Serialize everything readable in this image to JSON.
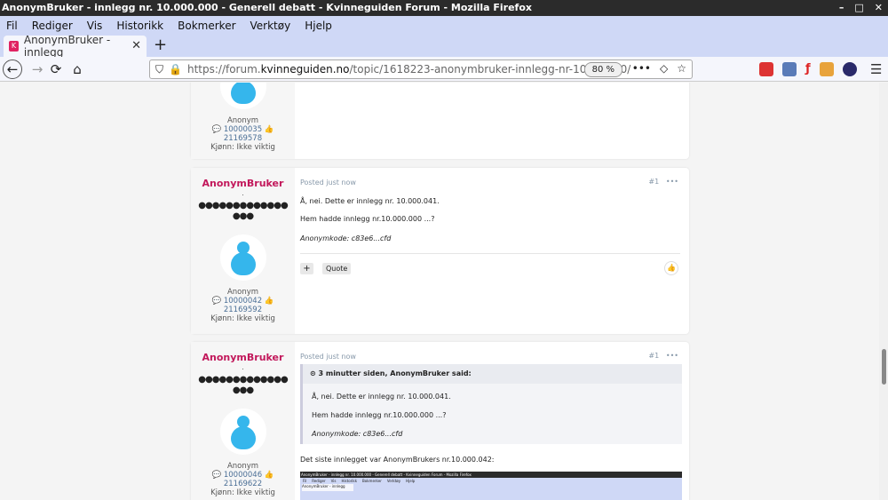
{
  "window": {
    "title": "AnonymBruker - innlegg nr. 10.000.000 - Generell debatt - Kvinneguiden Forum - Mozilla Firefox",
    "controls": [
      "–",
      "□",
      "✕"
    ]
  },
  "menu": [
    "Fil",
    "Rediger",
    "Vis",
    "Historikk",
    "Bokmerker",
    "Verktøy",
    "Hjelp"
  ],
  "tab": {
    "label": "AnonymBruker - innlegg",
    "close": "✕",
    "new": "+"
  },
  "nav": {
    "back": "←",
    "forward": "→",
    "reload": "⟳",
    "home": "⌂",
    "url_prefix": "https://forum.",
    "url_host": "kvinneguiden.no",
    "url_path": "/topic/1618223-anonymbruker-innlegg-nr-10000000/",
    "zoom": "80 %",
    "more": "•••"
  },
  "posts": [
    {
      "author_name": "",
      "avatar_label": "Anonym",
      "id_count": "10000035",
      "sub_id": "21169578",
      "gender": "Kjønn: Ikke viktig"
    },
    {
      "author_name": "AnonymBruker",
      "dots": "●●●●●●●●●●●●●\n●●●",
      "avatar_label": "Anonym",
      "id_count": "10000042",
      "sub_id": "21169592",
      "gender": "Kjønn: Ikke viktig",
      "posted": "Posted just now",
      "num": "#1",
      "more": "•••",
      "line1": "Å, nei. Dette er innlegg nr. 10.000.041.",
      "line2": "Hem hadde innlegg nr.10.000.000 ...?",
      "code": "Anonymkode: c83e6...cfd",
      "quote_label": "Quote",
      "plus": "+"
    },
    {
      "author_name": "AnonymBruker",
      "dots": "●●●●●●●●●●●●●\n●●●",
      "avatar_label": "Anonym",
      "id_count": "10000046",
      "sub_id": "21169622",
      "gender": "Kjønn: Ikke viktig",
      "posted": "Posted just now",
      "num": "#1",
      "more": "•••",
      "quote_head": "3 minutter siden, AnonymBruker said:",
      "q1": "Å, nei. Dette er innlegg nr. 10.000.041.",
      "q2": "Hem hadde innlegg nr.10.000.000 ...?",
      "qcode": "Anonymkode: c83e6...cfd",
      "line1": "Det siste innlegget var AnonymBrukers nr.10.000.042:"
    }
  ],
  "mini_screenshot": {
    "title": "AnonymBruker - innlegg nr. 10.000.000 - Generell debatt - Kvinneguiden Forum - Mozilla Firefox",
    "menu": [
      "Fil",
      "Rediger",
      "Vis",
      "Historikk",
      "Bokmerker",
      "Verktøy",
      "Hjelp"
    ],
    "tab": "AnonymBruker - innlegg"
  }
}
